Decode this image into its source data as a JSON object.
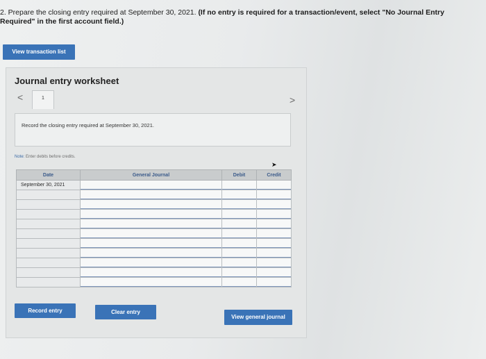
{
  "question": {
    "number": "2.",
    "text_normal": " Prepare the closing entry required at September 30, 2021. ",
    "text_bold": "(If no entry is required for a transaction/event, select \"No Journal Entry Required\" in the first account field.)"
  },
  "toolbar": {
    "view_transaction_list": "View transaction list"
  },
  "worksheet": {
    "title": "Journal entry worksheet",
    "nav_prev": "<",
    "nav_next": ">",
    "active_tab": "1",
    "instruction": "Record the closing entry required at September 30, 2021.",
    "note_label": "Note:",
    "note_text": " Enter debits before credits.",
    "columns": {
      "date": "Date",
      "general_journal": "General Journal",
      "debit": "Debit",
      "credit": "Credit"
    },
    "rows": [
      {
        "date": "September 30, 2021",
        "account": "",
        "debit": "",
        "credit": ""
      },
      {
        "date": "",
        "account": "",
        "debit": "",
        "credit": ""
      },
      {
        "date": "",
        "account": "",
        "debit": "",
        "credit": ""
      },
      {
        "date": "",
        "account": "",
        "debit": "",
        "credit": ""
      },
      {
        "date": "",
        "account": "",
        "debit": "",
        "credit": ""
      },
      {
        "date": "",
        "account": "",
        "debit": "",
        "credit": ""
      },
      {
        "date": "",
        "account": "",
        "debit": "",
        "credit": ""
      },
      {
        "date": "",
        "account": "",
        "debit": "",
        "credit": ""
      },
      {
        "date": "",
        "account": "",
        "debit": "",
        "credit": ""
      },
      {
        "date": "",
        "account": "",
        "debit": "",
        "credit": ""
      },
      {
        "date": "",
        "account": "",
        "debit": "",
        "credit": ""
      }
    ],
    "buttons": {
      "record": "Record entry",
      "clear": "Clear entry",
      "view_general": "View general journal"
    }
  }
}
